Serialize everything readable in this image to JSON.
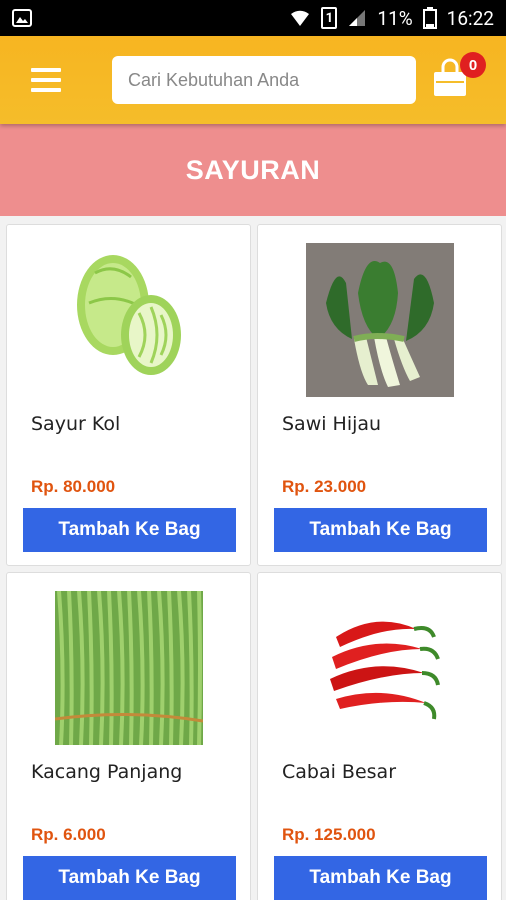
{
  "status_bar": {
    "battery": "11%",
    "time": "16:22",
    "sim": "1"
  },
  "header": {
    "search_placeholder": "Cari Kebutuhan Anda",
    "cart_count": "0"
  },
  "category": {
    "title": "SAYURAN"
  },
  "products": [
    {
      "name": "Sayur Kol",
      "price": "Rp. 80.000",
      "button": "Tambah Ke Bag",
      "image": "cabbage-image"
    },
    {
      "name": "Sawi Hijau",
      "price": "Rp. 23.000",
      "button": "Tambah Ke Bag",
      "image": "bok-choy-image"
    },
    {
      "name": "Kacang Panjang",
      "price": "Rp. 6.000",
      "button": "Tambah Ke Bag",
      "image": "long-beans-image"
    },
    {
      "name": "Cabai Besar",
      "price": "Rp. 125.000",
      "button": "Tambah Ke Bag",
      "image": "red-chili-image"
    }
  ],
  "colors": {
    "header": "#f7b521",
    "category_bar": "#ee8e8e",
    "button": "#3366e4",
    "price": "#e0540f",
    "badge": "#e02020"
  }
}
